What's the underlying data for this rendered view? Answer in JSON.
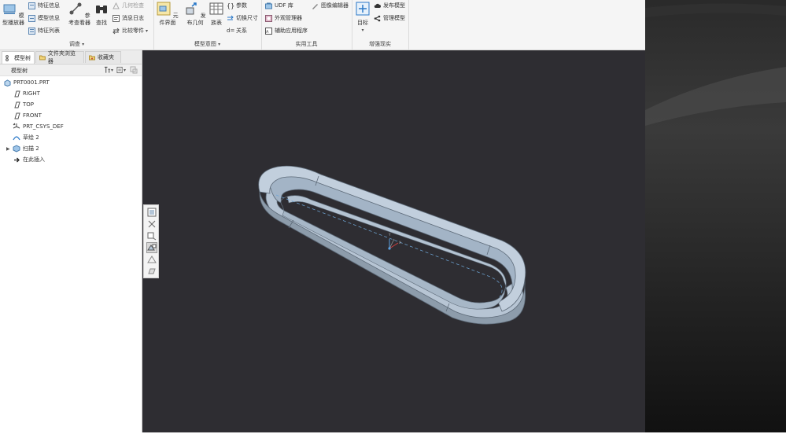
{
  "ribbon": {
    "investigate": {
      "model_player": "模型播放器",
      "feature_info": "特征信息",
      "model_info": "模型信息",
      "feature_list": "特征列表",
      "ref_viewer": "参考查看器",
      "find": "查找",
      "geom_check": "几何检查",
      "message_log": "消息日志",
      "compare_part": "比较零件",
      "group_label": "调查"
    },
    "model_intent": {
      "component_interface": "元件界面",
      "publish_geometry": "发布几何",
      "family_table": "族表",
      "parameters": "参数",
      "switch_dimensions": "切换尺寸",
      "relations": "关系",
      "group_label": "模型意图"
    },
    "utilities": {
      "udf_library": "UDF 库",
      "appearance_manager": "外观管理器",
      "aux_applications": "辅助应用程序",
      "image_editor": "图像编辑器",
      "group_label": "实用工具"
    },
    "ar": {
      "target": "目标",
      "publish_model": "发布模型",
      "manage_models": "管理模型",
      "group_label": "增强现实"
    }
  },
  "left_panel": {
    "tabs": [
      "模型树",
      "文件夹浏览器",
      "收藏夹"
    ],
    "tree_header": "模型树",
    "tree_items": [
      {
        "label": "PRT0001.PRT",
        "icon": "part-icon"
      },
      {
        "label": "RIGHT",
        "icon": "datum-plane-icon"
      },
      {
        "label": "TOP",
        "icon": "datum-plane-icon"
      },
      {
        "label": "FRONT",
        "icon": "datum-plane-icon"
      },
      {
        "label": "PRT_CSYS_DEF",
        "icon": "csys-icon"
      },
      {
        "label": "草绘 2",
        "icon": "sketch-icon"
      },
      {
        "label": "扫描 2",
        "icon": "sweep-icon"
      },
      {
        "label": "在此插入",
        "icon": "insert-arrow-icon"
      }
    ]
  },
  "colors": {
    "viewport_bg": "#2e2d32",
    "model_top": "#9fb1c6",
    "model_side": "#b9c6d4",
    "ribbon_bg": "#f5f5f5",
    "accent": "#2a78c8"
  }
}
